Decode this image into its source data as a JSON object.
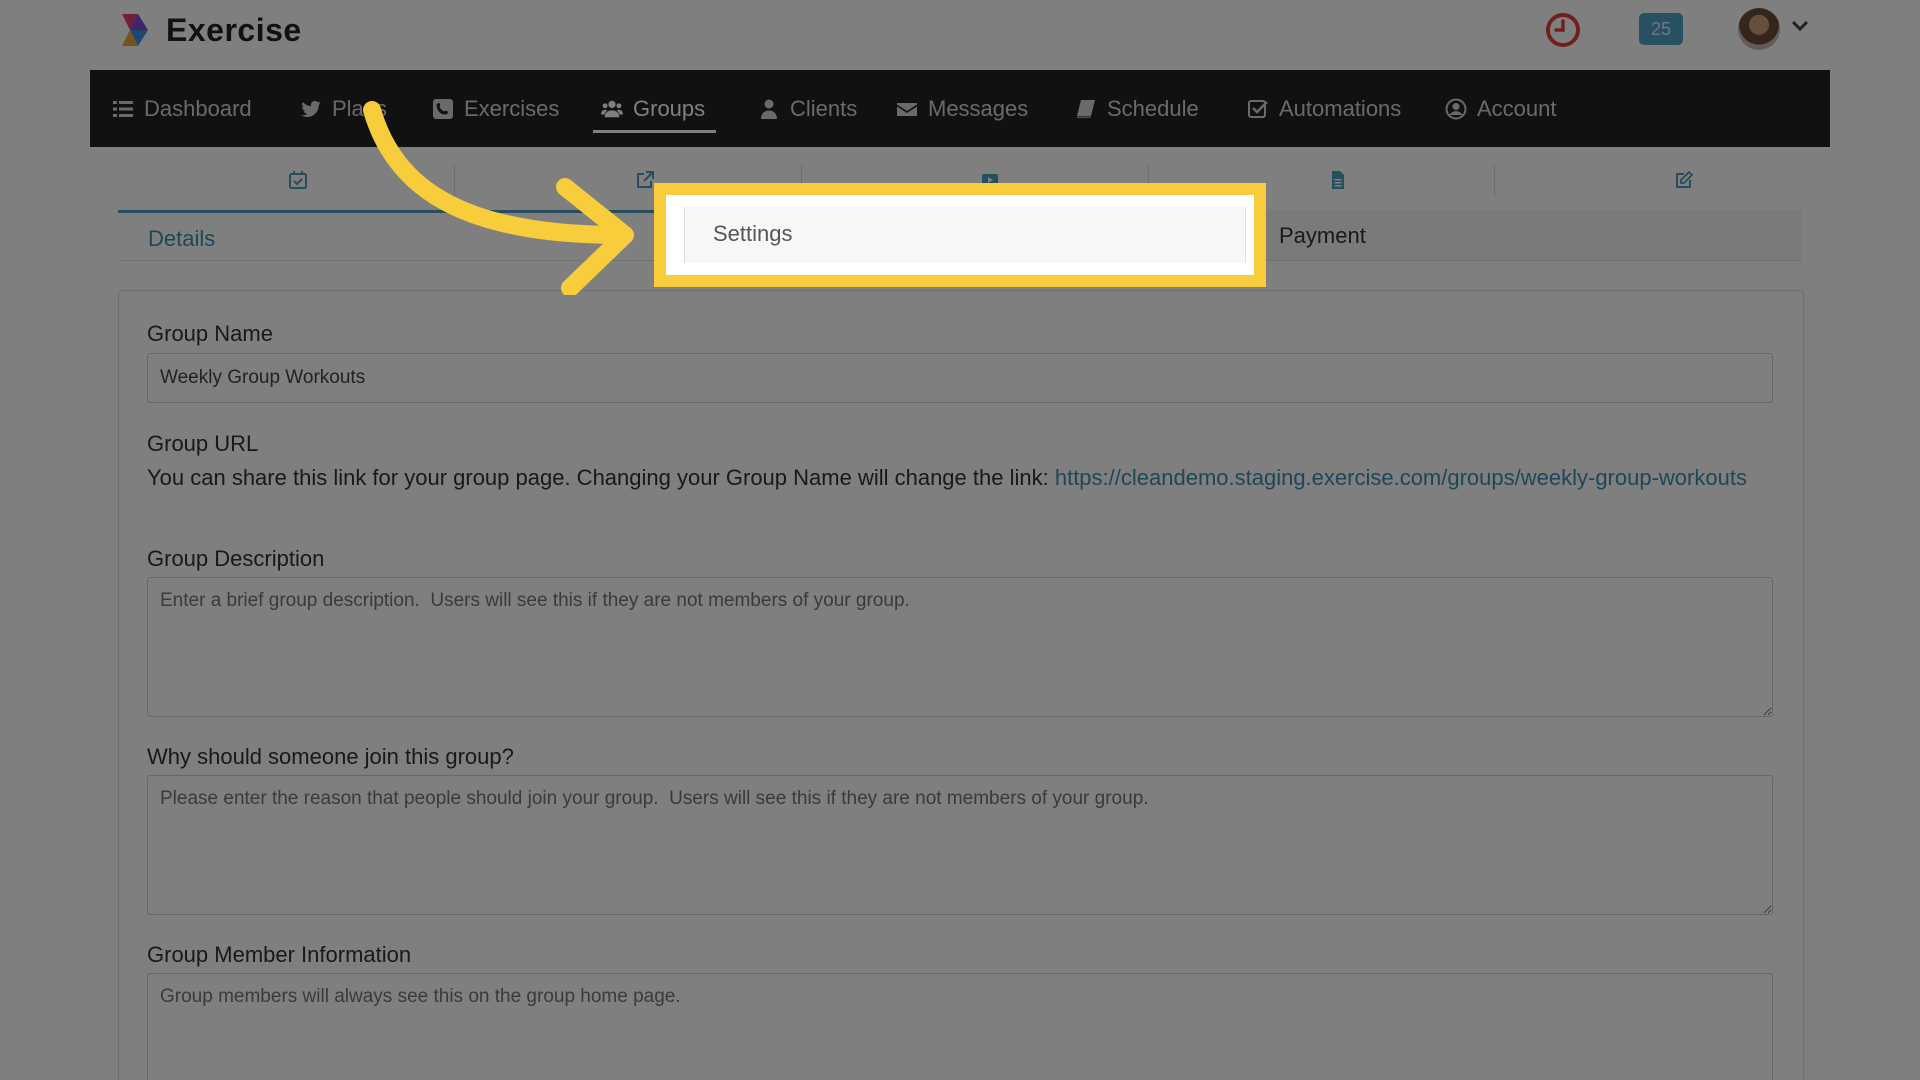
{
  "brand": {
    "name": "Exercise"
  },
  "topbar": {
    "notification_count": "25"
  },
  "nav": {
    "items": [
      {
        "label": "Dashboard",
        "icon": "list-icon"
      },
      {
        "label": "Plans",
        "icon": "twitter-icon"
      },
      {
        "label": "Exercises",
        "icon": "phone-square-icon"
      },
      {
        "label": "Groups",
        "icon": "users-icon",
        "active": true
      },
      {
        "label": "Clients",
        "icon": "user-icon"
      },
      {
        "label": "Messages",
        "icon": "envelope-icon"
      },
      {
        "label": "Schedule",
        "icon": "book-icon"
      },
      {
        "label": "Automations",
        "icon": "check-square-icon"
      },
      {
        "label": "Account",
        "icon": "user-circle-icon"
      }
    ]
  },
  "tabs": {
    "icons": [
      "calendar-check-icon",
      "external-link-icon",
      "video-icon",
      "file-icon",
      "edit-icon"
    ],
    "details": "Details",
    "settings": "Settings",
    "payment": "Payment"
  },
  "form": {
    "group_name": {
      "label": "Group Name",
      "value": "Weekly Group Workouts"
    },
    "group_url": {
      "label": "Group URL",
      "description": "You can share this link for your group page. Changing your Group Name will change the link:",
      "link": "https://cleandemo.staging.exercise.com/groups/weekly-group-workouts"
    },
    "group_description": {
      "label": "Group Description",
      "placeholder": "Enter a brief group description.  Users will see this if they are not members of your group."
    },
    "why_join": {
      "label": "Why should someone join this group?",
      "placeholder": "Please enter the reason that people should join your group.  Users will see this if they are not members of your group."
    },
    "member_info": {
      "label": "Group Member Information",
      "placeholder": "Group members will always see this on the group home page."
    }
  },
  "colors": {
    "accent": "#3d8db2",
    "highlight": "#f8cd3c",
    "navbar": "#222222",
    "badge": "#4fa3c7",
    "clock": "#e0403a"
  }
}
